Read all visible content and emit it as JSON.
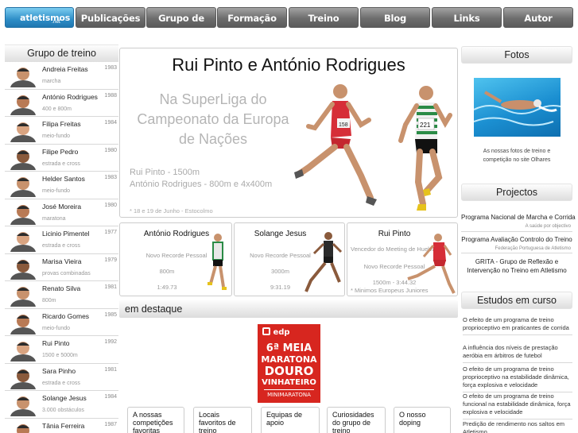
{
  "nav": {
    "logo": "atletismos",
    "logo_sub": ".net",
    "items": [
      "Publicações",
      "Grupo de treino",
      "Formação",
      "Treino",
      "Blog",
      "Links",
      "Autor"
    ]
  },
  "left": {
    "title": "Grupo de treino",
    "people": [
      {
        "name": "Andreia Freitas",
        "year": "1983",
        "event": "marcha"
      },
      {
        "name": "António Rodrigues",
        "year": "1988",
        "event": "400 e 800m"
      },
      {
        "name": "Filipa Freitas",
        "year": "1984",
        "event": "meio-fundo"
      },
      {
        "name": "Filipe Pedro",
        "year": "1980",
        "event": "estrada e cross"
      },
      {
        "name": "Helder Santos",
        "year": "1983",
        "event": "meio-fundo"
      },
      {
        "name": "José Moreira",
        "year": "1980",
        "event": "maratona"
      },
      {
        "name": "Licinio Pimentel",
        "year": "1977",
        "event": "estrada e cross"
      },
      {
        "name": "Marisa Vieira",
        "year": "1979",
        "event": "provas combinadas"
      },
      {
        "name": "Renato Silva",
        "year": "1981",
        "event": "800m"
      },
      {
        "name": "Ricardo Gomes",
        "year": "1985",
        "event": "meio-fundo"
      },
      {
        "name": "Rui Pinto",
        "year": "1992",
        "event": "1500 e 5000m"
      },
      {
        "name": "Sara Pinho",
        "year": "1981",
        "event": "estrada e cross"
      },
      {
        "name": "Solange Jesus",
        "year": "1984",
        "event": "3.000 obstáculos"
      },
      {
        "name": "Tânia Ferreira",
        "year": "1987",
        "event": ""
      }
    ]
  },
  "hero": {
    "title": "Rui Pinto e António Rodrigues",
    "subtitle_lines": [
      "Na SuperLiga do",
      "Campeonato da Europa",
      "de Nações"
    ],
    "event1": "Rui Pinto - 1500m",
    "event2": "António Rodrigues - 800m e 4x400m",
    "date": "* 18 e 19 de Junho - Estocolmo",
    "bib1": "158",
    "bib2": "221"
  },
  "cards": [
    {
      "title": "António Rodrigues",
      "lines": [
        "Novo Recorde Pessoal",
        "800m",
        "1:49.73"
      ],
      "bib": ""
    },
    {
      "title": "Solange Jesus",
      "lines": [
        "Novo Recorde Pessoal",
        "3000m",
        "9:31.19"
      ],
      "bib": ""
    },
    {
      "title": "Rui Pinto",
      "lines": [
        "Vencedor do Meeting de Huelva",
        "Novo Recorde Pessoal",
        "1500m - 3:44.32",
        "* Minimos Europeus Juniores"
      ],
      "bib": ""
    }
  ],
  "destaque": "em destaque",
  "promo": {
    "brand": "edp",
    "line1": "6ª MEIA",
    "line2": "MARATONA",
    "line3": "DOURO",
    "line4": "VINHATEIRO",
    "line5": "MINIMARATONA"
  },
  "tiles": [
    "A nossas competições favoritas",
    "Locais favoritos de treino",
    "Equipas de apoio",
    "Curiosidades do grupo de treino",
    "O nosso doping"
  ],
  "right": {
    "fotos_title": "Fotos",
    "fotos_caption": [
      "As nossas fotos de treino e",
      "competição no site Olhares"
    ],
    "projectos_title": "Projectos",
    "projects": [
      {
        "title": "Programa Nacional de Marcha e Corrida",
        "sub": "A saúde por objectivo"
      },
      {
        "title": "Programa Avaliação Controlo do Treino",
        "sub": "Federação Portuguesa de Atletismo"
      },
      {
        "title_lines": [
          "GRITA - Grupo de Reflexão e",
          "Intervenção no Treino em Atletismo"
        ]
      }
    ],
    "estudos_title": "Estudos em curso",
    "studies": [
      "O efeito de um programa de treino proprioceptivo em praticantes de corrida",
      "A influência dos níveis de prestação aeróbia em árbitros de futebol",
      "O efeito de um programa de treino proprioceptivo na estabilidade dinâmica, força explosiva e velocidade",
      "O efeito de um programa de treino funcional na estabilidade dinâmica, força explosiva e velocidade",
      "Predição de rendimento nos saltos em Atletismo"
    ]
  }
}
